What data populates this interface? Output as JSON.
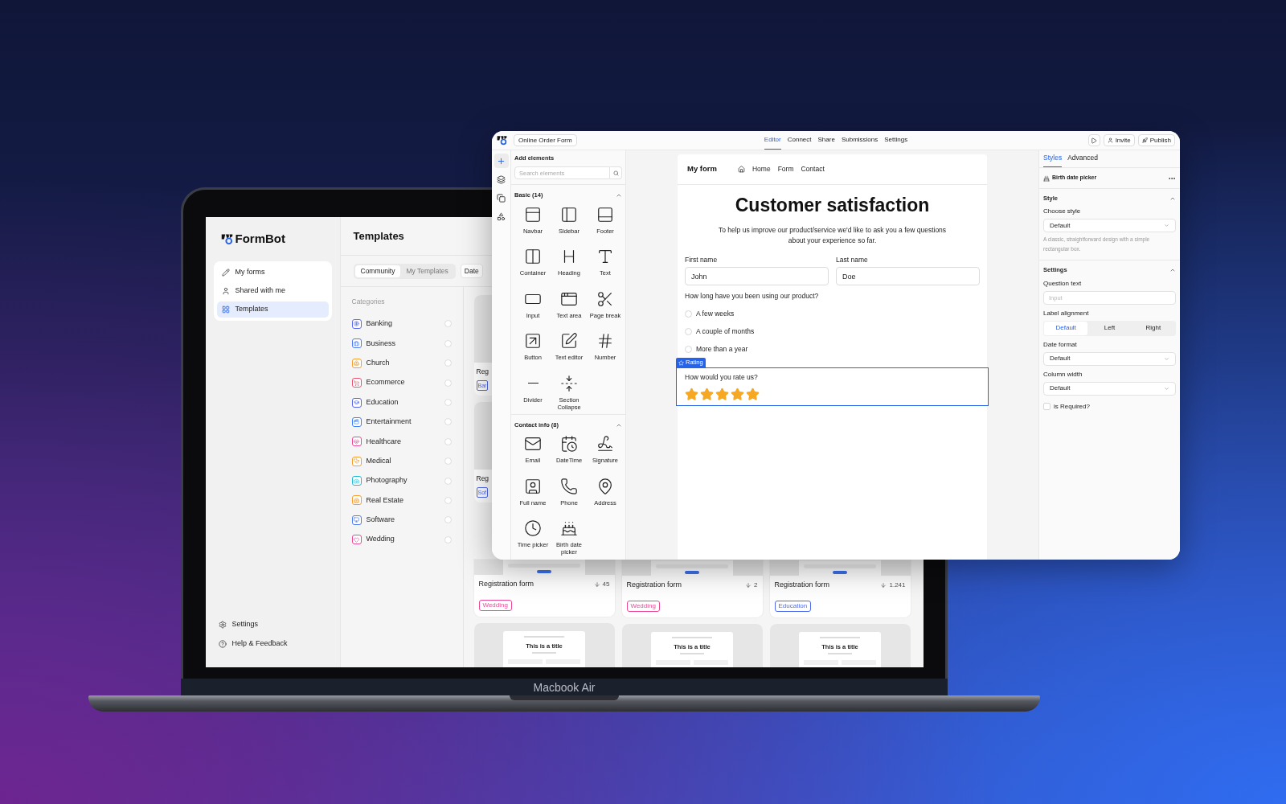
{
  "laptop": {
    "label": "Macbook Air",
    "app": {
      "logo": "FormBot",
      "nav": [
        {
          "label": "My forms",
          "selected": false
        },
        {
          "label": "Shared with me",
          "selected": false
        },
        {
          "label": "Templates",
          "selected": true
        }
      ],
      "footer_nav": [
        {
          "label": "Settings"
        },
        {
          "label": "Help & Feedback"
        }
      ],
      "title": "Templates",
      "tabs": [
        {
          "label": "Community",
          "selected": true
        },
        {
          "label": "My Templates",
          "selected": false
        }
      ],
      "filter_button": "Date",
      "categories_heading": "Categories",
      "categories": [
        {
          "label": "Banking",
          "color": "#5b6cf0",
          "checked": false
        },
        {
          "label": "Business",
          "color": "#4f7bf0",
          "checked": false
        },
        {
          "label": "Church",
          "color": "#f59e2b",
          "checked": false
        },
        {
          "label": "Ecommerce",
          "color": "#f0506e",
          "checked": false
        },
        {
          "label": "Education",
          "color": "#5566e8",
          "checked": false
        },
        {
          "label": "Entertainment",
          "color": "#3b82f6",
          "checked": false
        },
        {
          "label": "Healthcare",
          "color": "#ec4899",
          "checked": false
        },
        {
          "label": "Medical",
          "color": "#f59e2b",
          "checked": false
        },
        {
          "label": "Photography",
          "color": "#22b8d8",
          "checked": false
        },
        {
          "label": "Real Estate",
          "color": "#f59e2b",
          "checked": false
        },
        {
          "label": "Software",
          "color": "#4f7bf0",
          "checked": false
        },
        {
          "label": "Wedding",
          "color": "#ec4899",
          "checked": false
        }
      ],
      "partial_cards": [
        {
          "title": "Reg",
          "tag": "Bar",
          "color": "#4f6bed"
        },
        {
          "title": "Reg",
          "tag": "Sof",
          "color": "#4f6bed"
        }
      ],
      "cards": [
        {
          "title": "Registration form",
          "downloads": "45",
          "tag": "Wedding",
          "color": "#ec4899"
        },
        {
          "title": "Registration form",
          "downloads": "2",
          "tag": "Wedding",
          "color": "#ec4899"
        },
        {
          "title": "Registration form",
          "downloads": "1.241",
          "tag": "Education",
          "color": "#4f6bed"
        }
      ],
      "previews": [
        {
          "title": "This is a title"
        },
        {
          "title": "This is a title"
        },
        {
          "title": "This is a title"
        }
      ]
    }
  },
  "editor": {
    "form_name": "Online Order Form",
    "tabs": [
      {
        "label": "Editor",
        "selected": true
      },
      {
        "label": "Connect",
        "selected": false
      },
      {
        "label": "Share",
        "selected": false
      },
      {
        "label": "Submissions",
        "selected": false
      },
      {
        "label": "Settings",
        "selected": false
      }
    ],
    "actions": [
      {
        "label": "Invite"
      },
      {
        "label": "Publish"
      }
    ],
    "rail": [
      {
        "selected": true
      },
      {
        "selected": false
      },
      {
        "selected": false
      },
      {
        "selected": false
      }
    ],
    "panel": {
      "title": "Add elements",
      "search_placeholder": "Search elements",
      "sections": [
        {
          "title": "Basic (14)",
          "expanded": true,
          "items": [
            "Navbar",
            "Sidebar",
            "Footer",
            "Container",
            "Heading",
            "Text",
            "Input",
            "Text area",
            "Page break",
            "Button",
            "Text editor",
            "Number",
            "Divider",
            "Section Collapse"
          ]
        },
        {
          "title": "Contact info (8)",
          "expanded": true,
          "items": [
            "Email",
            "DateTime",
            "Signature",
            "Full name",
            "Phone",
            "Address",
            "Time picker",
            "Birth date picker"
          ]
        }
      ]
    },
    "canvas": {
      "brand": "My form",
      "links": [
        "Home",
        "Form",
        "Contact"
      ],
      "heading": "Customer satisfaction",
      "intro": "To help us improve our product/service we'd like to ask you a few questions about your experience so far.",
      "fields": [
        {
          "label": "First name",
          "value": "John"
        },
        {
          "label": "Last name",
          "value": "Doe"
        }
      ],
      "question": "How long have you been using our product?",
      "options": [
        {
          "label": "A few weeks",
          "selected": false
        },
        {
          "label": "A couple of months",
          "selected": false
        },
        {
          "label": "More than a year",
          "selected": false
        }
      ],
      "rating": {
        "badge": "Rating",
        "question": "How would you rate us?",
        "stars": 5
      }
    },
    "inspector": {
      "tabs": [
        {
          "label": "Styles",
          "selected": true
        },
        {
          "label": "Advanced",
          "selected": false
        }
      ],
      "element": "Birth date picker",
      "style_section": {
        "title": "Style",
        "expanded": true,
        "label": "Choose style",
        "value": "Default",
        "help": "A classic, straightforward design with a simple rectangular box."
      },
      "settings_section": {
        "title": "Settings",
        "expanded": true,
        "question_label": "Question text",
        "question_placeholder": "Input",
        "alignment_label": "Label alignment",
        "alignment": [
          {
            "label": "Default",
            "selected": true
          },
          {
            "label": "Left",
            "selected": false
          },
          {
            "label": "Right",
            "selected": false
          }
        ],
        "date_format": {
          "label": "Date format",
          "value": "Default"
        },
        "column_width": {
          "label": "Column width",
          "value": "Default"
        },
        "required": {
          "label": "is Required?",
          "checked": false
        }
      }
    }
  }
}
